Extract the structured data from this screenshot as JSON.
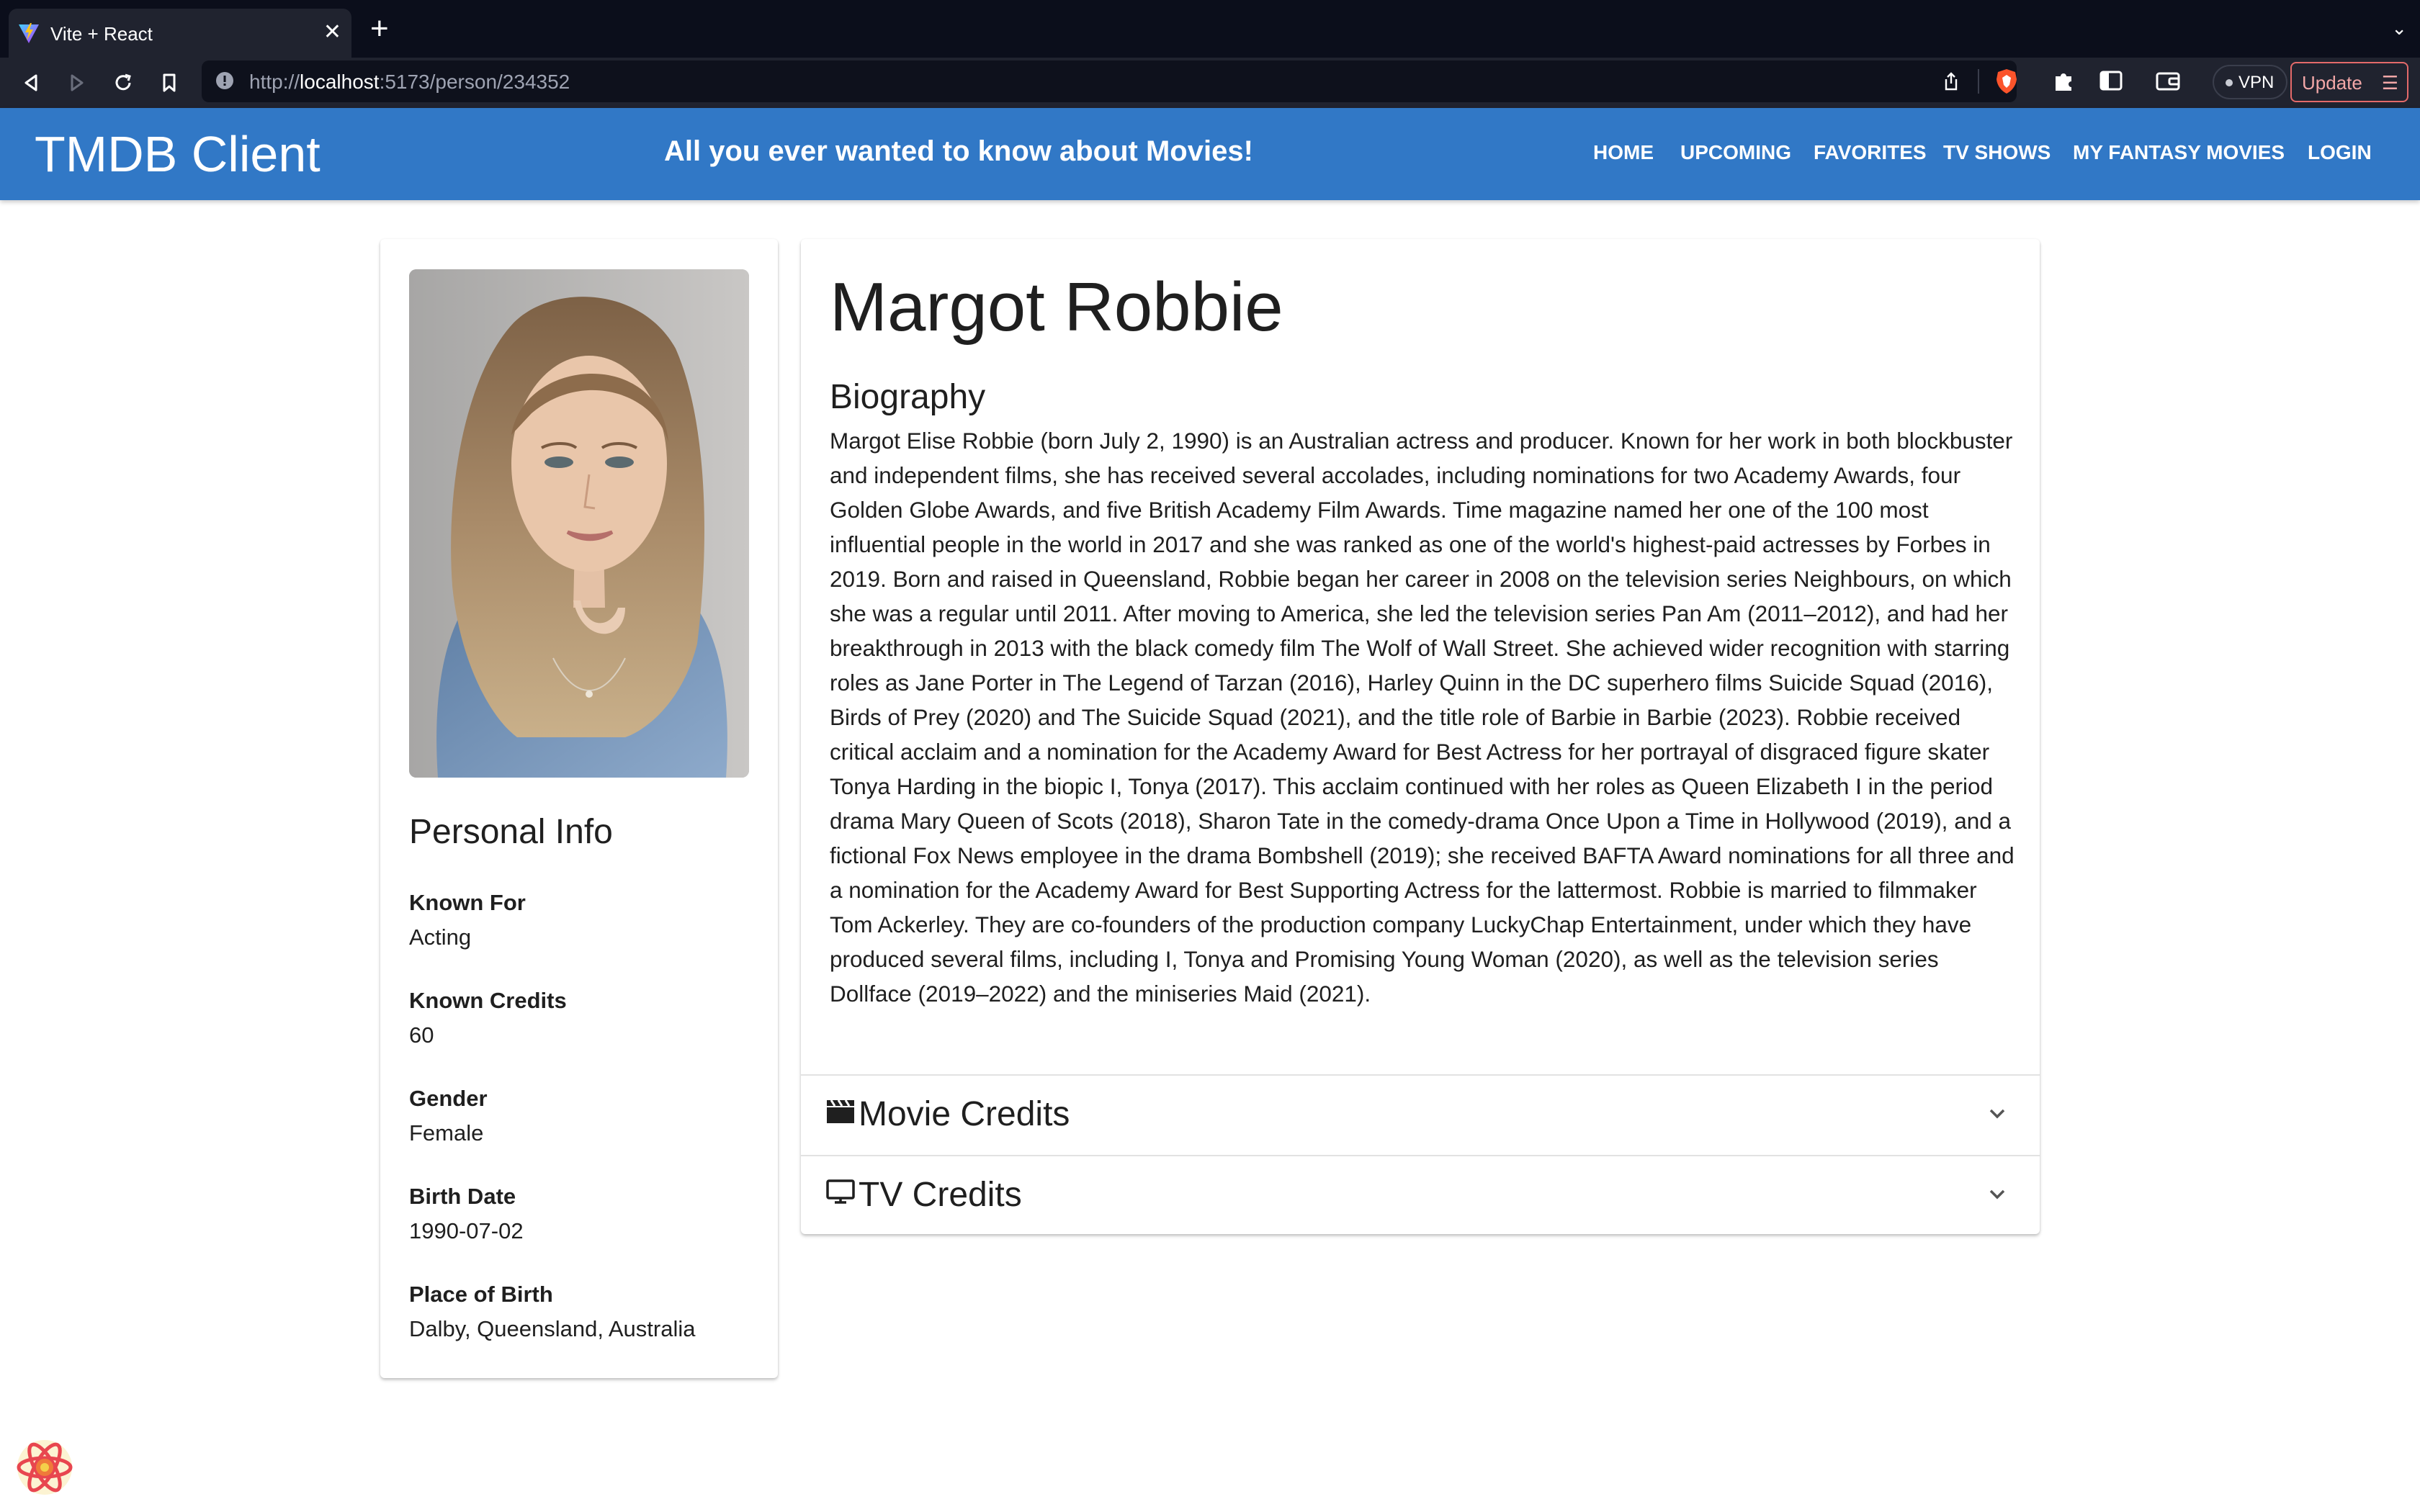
{
  "browser": {
    "tab_title": "Vite + React",
    "url_scheme": "http://",
    "url_host": "localhost",
    "url_path": ":5173/person/234352",
    "vpn_label": "VPN",
    "update_label": "Update"
  },
  "header": {
    "title": "TMDB Client",
    "tagline": "All you ever wanted to know about Movies!",
    "nav": [
      "HOME",
      "UPCOMING",
      "FAVORITES",
      "TV SHOWS",
      "MY FANTASY MOVIES",
      "LOGIN"
    ]
  },
  "personal_info": {
    "heading": "Personal Info",
    "fields": [
      {
        "label": "Known For",
        "value": "Acting"
      },
      {
        "label": "Known Credits",
        "value": "60"
      },
      {
        "label": "Gender",
        "value": "Female"
      },
      {
        "label": "Birth Date",
        "value": "1990-07-02"
      },
      {
        "label": "Place of Birth",
        "value": "Dalby, Queensland, Australia"
      }
    ]
  },
  "person": {
    "name": "Margot Robbie",
    "bio_heading": "Biography",
    "biography": "Margot Elise Robbie (born July 2, 1990) is an Australian actress and producer. Known for her work in both blockbuster and independent films, she has received several accolades, including nominations for two Academy Awards, four Golden Globe Awards, and five British Academy Film Awards. Time magazine named her one of the 100 most influential people in the world in 2017 and she was ranked as one of the world's highest-paid actresses by Forbes in 2019. Born and raised in Queensland, Robbie began her career in 2008 on the television series Neighbours, on which she was a regular until 2011. After moving to America, she led the television series Pan Am (2011–2012), and had her breakthrough in 2013 with the black comedy film The Wolf of Wall Street. She achieved wider recognition with starring roles as Jane Porter in The Legend of Tarzan (2016), Harley Quinn in the DC superhero films Suicide Squad (2016), Birds of Prey (2020) and The Suicide Squad (2021), and the title role of Barbie in Barbie (2023). Robbie received critical acclaim and a nomination for the Academy Award for Best Actress for her portrayal of disgraced figure skater Tonya Harding in the biopic I, Tonya (2017). This acclaim continued with her roles as Queen Elizabeth I in the period drama Mary Queen of Scots (2018), Sharon Tate in the comedy-drama Once Upon a Time in Hollywood (2019), and a fictional Fox News employee in the drama Bombshell (2019); she received BAFTA Award nominations for all three and a nomination for the Academy Award for Best Supporting Actress for the lattermost. Robbie is married to filmmaker Tom Ackerley. They are co-founders of the production company LuckyChap Entertainment, under which they have produced several films, including I, Tonya and Promising Young Woman (2020), as well as the television series Dollface (2019–2022) and the miniseries Maid (2021)."
  },
  "accordions": [
    {
      "label": "Movie Credits",
      "icon": "clapperboard-icon"
    },
    {
      "label": "TV Credits",
      "icon": "tv-icon"
    }
  ],
  "colors": {
    "header_bg": "#3178c6",
    "chrome_bg": "#20232f",
    "tabbar_bg": "#0b0e1b"
  }
}
